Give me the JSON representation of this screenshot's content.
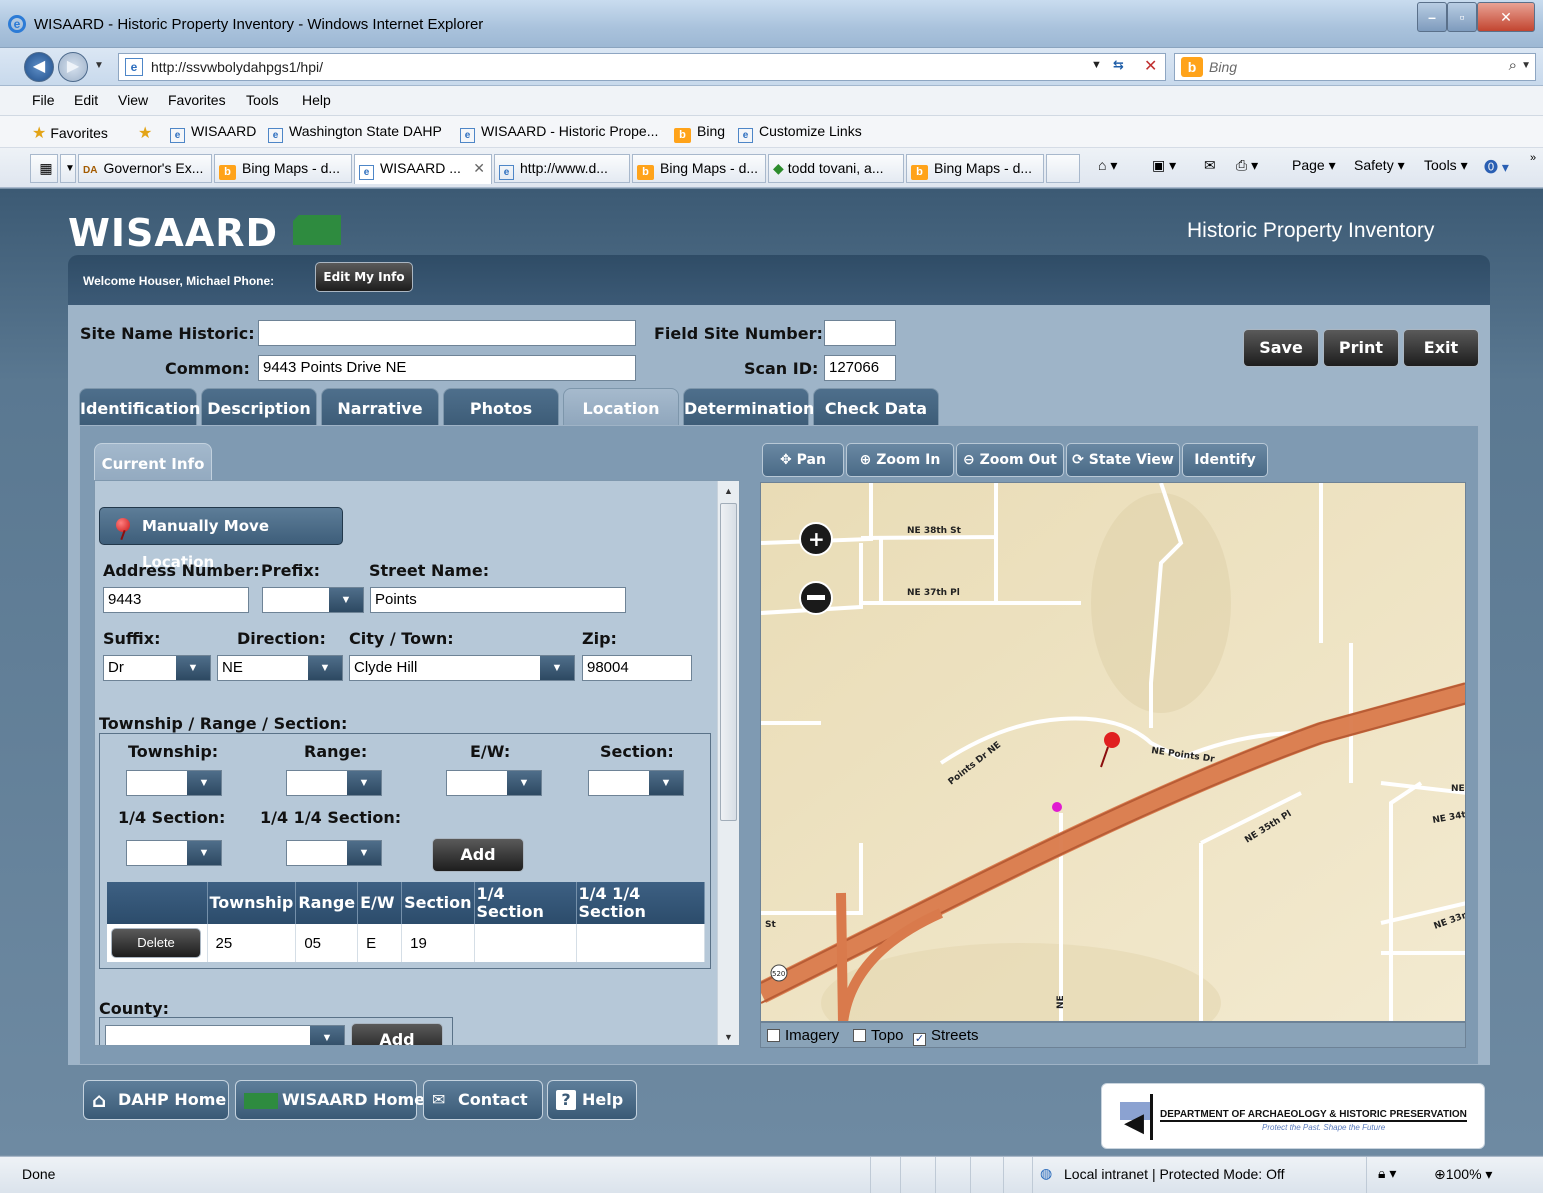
{
  "window": {
    "title": "WISAARD - Historic Property Inventory - Windows Internet Explorer"
  },
  "browser": {
    "url": "http://ssvwbolydahpgs1/hpi/",
    "search_placeholder": "Bing",
    "menu": [
      "File",
      "Edit",
      "View",
      "Favorites",
      "Tools",
      "Help"
    ],
    "favorites_label": "Favorites",
    "favorites": [
      "WISAARD",
      "Washington State DAHP",
      "WISAARD - Historic Prope...",
      "Bing",
      "Customize Links"
    ],
    "tabs": [
      "Governor's Ex...",
      "Bing Maps - d...",
      "WISAARD ...",
      "http://www.d...",
      "Bing Maps - d...",
      "todd tovani, a...",
      "Bing Maps - d..."
    ],
    "active_tab_index": 2,
    "toolbar": {
      "page": "Page",
      "safety": "Safety",
      "tools": "Tools"
    },
    "status": {
      "left": "Done",
      "zone": "Local intranet | Protected Mode: Off",
      "zoom": "100%"
    }
  },
  "app": {
    "logo": "WISAARD",
    "title": "Historic Property Inventory",
    "welcome": "Welcome Houser, Michael  Phone:",
    "edit_info_label": "Edit My Info",
    "header": {
      "site_name_historic_label": "Site Name Historic:",
      "site_name_historic_value": "",
      "common_label": "Common:",
      "common_value": "9443 Points Drive NE",
      "field_site_number_label": "Field Site Number:",
      "field_site_number_value": "",
      "scan_id_label": "Scan ID:",
      "scan_id_value": "127066"
    },
    "actions": {
      "save": "Save",
      "print": "Print",
      "exit": "Exit"
    },
    "tabs": [
      "Identification",
      "Description",
      "Narrative",
      "Photos",
      "Location",
      "Determination",
      "Check Data"
    ],
    "active_tab": "Location",
    "current_info_tab": "Current Info",
    "location": {
      "move_button": "Manually Move Location",
      "address_number_label": "Address Number:",
      "address_number": "9443",
      "prefix_label": "Prefix:",
      "prefix": "",
      "street_name_label": "Street Name:",
      "street_name": "Points",
      "suffix_label": "Suffix:",
      "suffix": "Dr",
      "direction_label": "Direction:",
      "direction": "NE",
      "city_label": "City / Town:",
      "city": "Clyde Hill",
      "zip_label": "Zip:",
      "zip": "98004",
      "trs_title": "Township / Range / Section:",
      "township_label": "Township:",
      "range_label": "Range:",
      "ew_label": "E/W:",
      "section_label": "Section:",
      "quarter_label": "1/4 Section:",
      "quarter_quarter_label": "1/4 1/4 Section:",
      "add_label": "Add",
      "table_headers": [
        "Township",
        "Range",
        "E/W",
        "Section",
        "1/4 Section",
        "1/4 1/4 Section"
      ],
      "table_rows": [
        {
          "delete": "Delete",
          "township": "25",
          "range": "05",
          "ew": "E",
          "section": "19",
          "quarter": "",
          "quarter_quarter": ""
        }
      ],
      "county_label": "County:",
      "county_add_label": "Add"
    },
    "map": {
      "tools": [
        "Pan",
        "Zoom In",
        "Zoom Out",
        "State View",
        "Identify"
      ],
      "street_labels": {
        "ne38": "NE 38th St",
        "ne37": "NE 37th Pl",
        "points_dr_ne": "Points Dr NE",
        "ne_points_dr": "NE Points Dr",
        "ne35": "NE 35th Pl",
        "ne_right": "NE",
        "ne34": "NE 34t",
        "ne33": "NE 33r",
        "st": "St",
        "hwy": "520",
        "ne_vertical": "NE"
      },
      "layers": [
        {
          "label": "Imagery",
          "checked": false
        },
        {
          "label": "Topo",
          "checked": false
        },
        {
          "label": "Streets",
          "checked": true
        }
      ]
    },
    "footer": {
      "dahp_home": "DAHP Home",
      "wisaard_home": "WISAARD Home",
      "contact": "Contact",
      "help": "Help",
      "dahp_logo_text": "DEPARTMENT OF ARCHAEOLOGY & HISTORIC PRESERVATION",
      "dahp_tagline": "Protect the Past. Shape the Future"
    }
  }
}
